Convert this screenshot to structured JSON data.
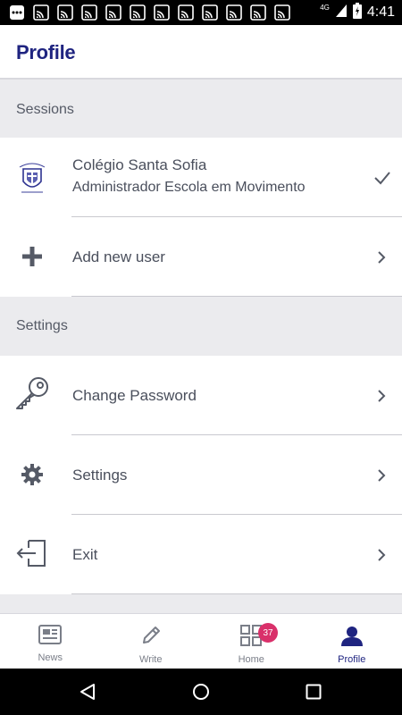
{
  "status_bar": {
    "time": "4:41",
    "network": "4G",
    "notification_icons": [
      "more-horiz-icon",
      "cast-icon",
      "cast-icon",
      "cast-icon",
      "cast-icon",
      "cast-icon",
      "cast-icon",
      "cast-icon",
      "cast-icon",
      "cast-icon",
      "cast-icon",
      "cast-icon"
    ]
  },
  "app_bar": {
    "title": "Profile"
  },
  "sessions": {
    "header": "Sessions",
    "current": {
      "school": "Colégio Santa Sofia",
      "role": "Administrador Escola em Movimento"
    },
    "add_label": "Add new user"
  },
  "settings": {
    "header": "Settings",
    "items": [
      {
        "label": "Change Password",
        "icon": "key-icon"
      },
      {
        "label": "Settings",
        "icon": "gear-icon"
      },
      {
        "label": "Exit",
        "icon": "exit-icon"
      }
    ]
  },
  "bottom_nav": {
    "items": [
      {
        "label": "News",
        "icon": "newspaper-icon"
      },
      {
        "label": "Write",
        "icon": "pencil-icon"
      },
      {
        "label": "Home",
        "icon": "grid-icon",
        "badge": "37"
      },
      {
        "label": "Profile",
        "icon": "person-icon",
        "active": true
      }
    ]
  },
  "colors": {
    "brand": "#1f2480",
    "badge": "#d9306a",
    "background": "#ebebee",
    "text": "#4a4f5c"
  }
}
